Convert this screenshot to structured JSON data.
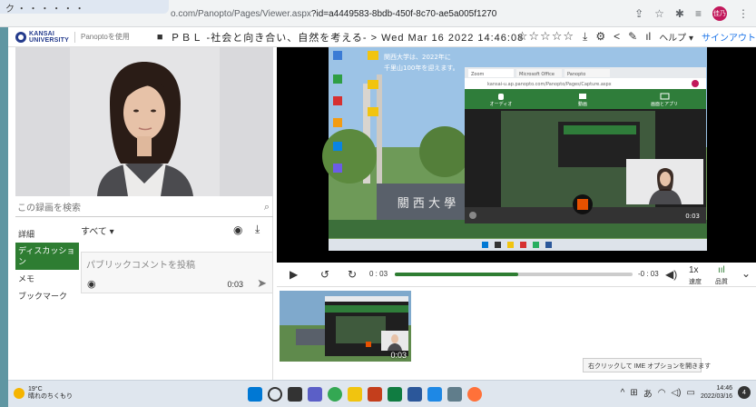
{
  "browser": {
    "tab_title": "ク ・ ・ ・ ・ ・ ・",
    "url_prefix": "o.com/Panopto/Pages/Viewer.aspx",
    "url_query": "?id=a4449583-8bdb-450f-8c70-ae5a005f1270",
    "profile_initials": "佳乃"
  },
  "header": {
    "logo_line1": "KANSAI",
    "logo_line2": "UNIVERSITY",
    "using": "Panoptoを使用",
    "title": "ＰＢＬ -社会と向き合い、自然を考える- > Wed Mar 16 2022 14:46:08",
    "stars": "☆☆☆☆☆",
    "help": "ヘルプ ▾",
    "signin": "サインアウト"
  },
  "search": {
    "placeholder": "この録画を検索"
  },
  "sidenav": {
    "items": [
      {
        "label": "詳細"
      },
      {
        "label": "ディスカッション"
      },
      {
        "label": "メモ"
      },
      {
        "label": "ブックマーク"
      }
    ]
  },
  "comments": {
    "filter": "すべて ▾",
    "placeholder": "パブリックコメントを投稿",
    "time": "0:03"
  },
  "controls": {
    "time_current": "0 : 03",
    "time_remaining": "-0 : 03",
    "progress": 0.52,
    "speed_value": "1x",
    "speed_label": "速度",
    "quality_label": "品質"
  },
  "video": {
    "desktop_text_1": "関西大学は、2022年に",
    "desktop_text_2": "千里山100年を迎えます。",
    "inner_time": "0:03",
    "inner_tab_1": "Zoom",
    "inner_tab_2": "Microsoft Office",
    "inner_tab_3": "Panopto",
    "inner_url": "kansai-u.ap.panopto.com/Panopto/Pages/Capture.aspx",
    "inner_tool_1": "オーディオ",
    "inner_tool_2": "動画",
    "inner_tool_3": "画面とアプリ",
    "sign_text": "關 西 大 學"
  },
  "thumbnail": {
    "time": "0:03"
  },
  "ime_tip": "右クリックして IME オプションを開きます",
  "taskbar": {
    "temp": "19°C",
    "weather": "晴れのちくもり",
    "ime": "あ",
    "time": "14:46",
    "date": "2022/03/16",
    "notif": "4"
  }
}
